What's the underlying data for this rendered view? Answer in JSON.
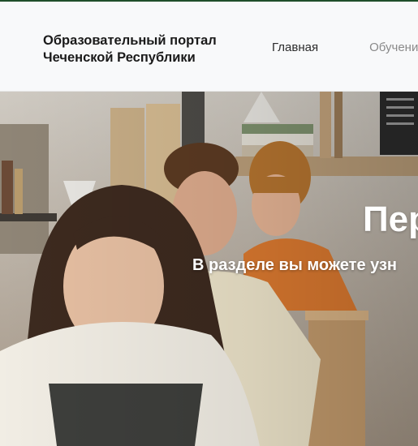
{
  "header": {
    "brand_line1": "Образовательный портал",
    "brand_line2": "Чеченской Республики",
    "nav": [
      {
        "label": "Главная"
      },
      {
        "label": "Обучени"
      }
    ]
  },
  "hero": {
    "title": "Пер",
    "subtitle": "В разделе вы можете узн",
    "image": "classroom-students-photo"
  },
  "colors": {
    "top_strip": "#1f4e2a",
    "header_bg": "#f8f9fa",
    "brand_text": "#1a1a1a",
    "nav_active": "#2b2b2b",
    "nav_muted": "#8a8a8a"
  }
}
